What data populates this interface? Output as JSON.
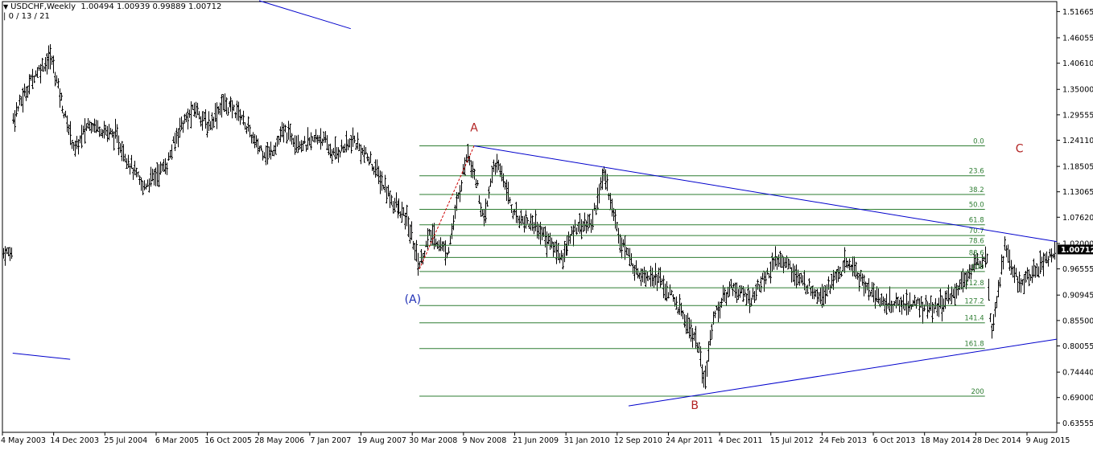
{
  "header": {
    "symbol": "USDCHF,Weekly",
    "ohlc": "1.00494 1.00939 0.99889 1.00712",
    "indicator": "0 / 13 / 21"
  },
  "chart_data": {
    "type": "bar",
    "symbol": "USDCHF",
    "timeframe": "Weekly",
    "current_price": "1.00712",
    "ylim": [
      0.6155,
      1.538
    ],
    "y_ticks": [
      "1.51665",
      "1.46055",
      "1.40610",
      "1.35000",
      "1.29555",
      "1.24110",
      "1.18505",
      "1.13065",
      "1.07620",
      "1.02000",
      "0.96555",
      "0.90945",
      "0.85500",
      "0.80055",
      "0.74440",
      "0.69000",
      "0.63555"
    ],
    "x_ticks": [
      "4 May 2003",
      "14 Dec 2003",
      "25 Jul 2004",
      "6 Mar 2005",
      "16 Oct 2005",
      "28 May 2006",
      "7 Jan 2007",
      "19 Aug 2007",
      "30 Mar 2008",
      "9 Nov 2008",
      "21 Jun 2009",
      "31 Jan 2010",
      "12 Sep 2010",
      "24 Apr 2011",
      "4 Dec 2011",
      "15 Jul 2012",
      "24 Feb 2013",
      "6 Oct 2013",
      "18 May 2014",
      "28 Dec 2014",
      "9 Aug 2015"
    ],
    "price_path": [
      [
        "2003-05-04",
        1.29
      ],
      [
        "2003-08-01",
        1.38
      ],
      [
        "2003-10-15",
        1.42
      ],
      [
        "2003-12-14",
        1.3
      ],
      [
        "2004-02-01",
        1.22
      ],
      [
        "2004-04-01",
        1.28
      ],
      [
        "2004-07-25",
        1.25
      ],
      [
        "2004-11-20",
        1.14
      ],
      [
        "2005-03-06",
        1.19
      ],
      [
        "2005-05-01",
        1.27
      ],
      [
        "2005-07-10",
        1.31
      ],
      [
        "2005-09-01",
        1.27
      ],
      [
        "2005-11-01",
        1.32
      ],
      [
        "2006-01-20",
        1.3
      ],
      [
        "2006-04-01",
        1.23
      ],
      [
        "2006-05-28",
        1.21
      ],
      [
        "2006-08-01",
        1.26
      ],
      [
        "2006-11-01",
        1.23
      ],
      [
        "2007-01-07",
        1.25
      ],
      [
        "2007-03-01",
        1.21
      ],
      [
        "2007-06-01",
        1.24
      ],
      [
        "2007-08-19",
        1.19
      ],
      [
        "2007-11-15",
        1.11
      ],
      [
        "2008-01-20",
        1.07
      ],
      [
        "2008-03-15",
        0.975
      ],
      [
        "2008-05-01",
        1.04
      ],
      [
        "2008-07-15",
        1.0
      ],
      [
        "2008-09-01",
        1.12
      ],
      [
        "2008-10-10",
        1.22
      ],
      [
        "2008-11-20",
        1.15
      ],
      [
        "2008-12-20",
        1.06
      ],
      [
        "2009-02-01",
        1.19
      ],
      [
        "2009-03-10",
        1.17
      ],
      [
        "2009-05-01",
        1.08
      ],
      [
        "2009-08-01",
        1.06
      ],
      [
        "2009-11-25",
        0.99
      ],
      [
        "2010-02-01",
        1.06
      ],
      [
        "2010-04-01",
        1.06
      ],
      [
        "2010-06-01",
        1.17
      ],
      [
        "2010-08-01",
        1.04
      ],
      [
        "2010-10-15",
        0.96
      ],
      [
        "2011-01-15",
        0.95
      ],
      [
        "2011-04-24",
        0.88
      ],
      [
        "2011-07-15",
        0.8
      ],
      [
        "2011-08-09",
        0.71
      ],
      [
        "2011-09-15",
        0.86
      ],
      [
        "2011-12-04",
        0.93
      ],
      [
        "2012-03-01",
        0.9
      ],
      [
        "2012-06-01",
        0.97
      ],
      [
        "2012-07-15",
        0.99
      ],
      [
        "2012-10-01",
        0.94
      ],
      [
        "2013-01-01",
        0.91
      ],
      [
        "2013-05-01",
        0.98
      ],
      [
        "2013-08-01",
        0.92
      ],
      [
        "2013-10-06",
        0.89
      ],
      [
        "2014-02-01",
        0.89
      ],
      [
        "2014-05-18",
        0.88
      ],
      [
        "2014-08-01",
        0.91
      ],
      [
        "2014-10-15",
        0.96
      ],
      [
        "2014-12-28",
        1.0
      ],
      [
        "2015-01-15",
        0.83
      ],
      [
        "2015-03-15",
        1.01
      ],
      [
        "2015-05-15",
        0.93
      ],
      [
        "2015-08-09",
        0.97
      ],
      [
        "2015-10-15",
        1.0
      ]
    ],
    "fibonacci_levels": [
      {
        "label": "0.0",
        "value": 1.229
      },
      {
        "label": "23.6",
        "value": 1.165
      },
      {
        "label": "38.2",
        "value": 1.125
      },
      {
        "label": "50.0",
        "value": 1.093
      },
      {
        "label": "61.8",
        "value": 1.06
      },
      {
        "label": "70.7",
        "value": 1.037
      },
      {
        "label": "78.6",
        "value": 1.016
      },
      {
        "label": "88.6",
        "value": 0.99
      },
      {
        "label": "100",
        "value": 0.96
      },
      {
        "label": "112.8",
        "value": 0.925
      },
      {
        "label": "127.2",
        "value": 0.887
      },
      {
        "label": "141.4",
        "value": 0.85
      },
      {
        "label": "161.8",
        "value": 0.795
      },
      {
        "label": "200",
        "value": 0.693
      }
    ],
    "wave_labels": [
      {
        "text": "A",
        "date": "2008-11-09",
        "value": 1.26,
        "color": "#b22222"
      },
      {
        "text": "B",
        "date": "2011-07-01",
        "value": 0.665,
        "color": "#b22222"
      },
      {
        "text": "C",
        "date": "2015-05-20",
        "value": 1.215,
        "color": "#b22222"
      },
      {
        "text": "(A)",
        "date": "2008-02-15",
        "value": 0.893,
        "color": "#1f2fb5"
      }
    ],
    "trendlines": [
      {
        "from": [
          "2008-11-09",
          1.229
        ],
        "to": [
          "2015-10-30",
          1.024
        ],
        "color": "#0000cc"
      },
      {
        "from": [
          "2010-09-15",
          0.672
        ],
        "to": [
          "2015-10-30",
          0.815
        ],
        "color": "#0000cc"
      },
      {
        "from": [
          "2006-04-15",
          1.54
        ],
        "to": [
          "2007-05-20",
          1.48
        ],
        "color": "#0000cc"
      },
      {
        "from": [
          "2003-05-04",
          0.785
        ],
        "to": [
          "2004-01-10",
          0.772
        ],
        "color": "#0000cc"
      }
    ],
    "dashed_line": {
      "from": [
        "2008-03-15",
        0.965
      ],
      "to": [
        "2008-11-09",
        1.229
      ],
      "color": "#cc0000"
    },
    "fib_start": "2008-03-15",
    "fib_end": "2014-12-20",
    "colors": {
      "bars": "#000000",
      "fib": "#2e7d32",
      "fib_label": "#2e7d32",
      "trend": "#0000cc",
      "wave": "#b22222",
      "wave_A": "#1f2fb5",
      "price_box": "#000000",
      "price_text": "#ffffff"
    },
    "grid": false
  }
}
